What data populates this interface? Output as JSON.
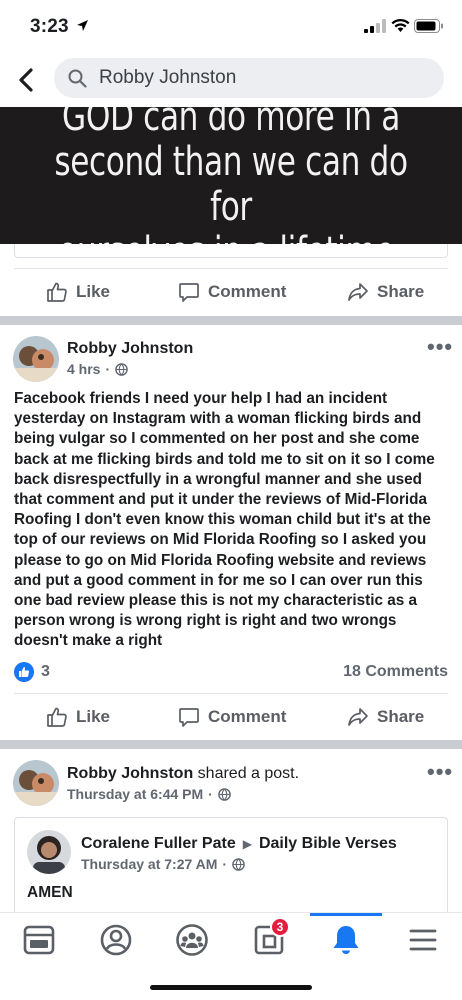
{
  "status_bar": {
    "time": "3:23"
  },
  "header": {
    "search_value": "Robby Johnston"
  },
  "banner": {
    "line1": "GOD can do more in a",
    "line2": "second than we can do for",
    "line3": "ourselves in a lifetime."
  },
  "actions": {
    "like": "Like",
    "comment": "Comment",
    "share": "Share"
  },
  "post1": {
    "author": "Robby Johnston",
    "time": "4 hrs",
    "separator": "·",
    "body": "Facebook friends I need your help I had an incident yesterday on Instagram with a woman flicking birds and being vulgar so I commented on her post and she come back at me flicking birds and told me to sit on it so I come back disrespectfully in a wrongful manner and she used that comment and put it under the reviews of Mid-Florida Roofing I don't even know this woman child but it's at the top of our reviews on Mid Florida Roofing so I asked you please to go on Mid Florida Roofing website and reviews and put a good comment in for me so I can over run this one bad review please this is not my characteristic as a person wrong is wrong right is right and two wrongs doesn't make a right",
    "reaction_count": "3",
    "comments": "18 Comments"
  },
  "post2": {
    "author": "Robby Johnston",
    "action_text": "shared a post.",
    "time": "Thursday at 6:44 PM",
    "separator": "·",
    "shared": {
      "author": "Coralene Fuller Pate",
      "arrow": "▶",
      "page": "Daily Bible Verses",
      "time": "Thursday at 7:27 AM",
      "separator": "·",
      "body": "AMEN"
    }
  },
  "tab_bar": {
    "notification_badge": "3",
    "active_tab": "notifications"
  },
  "colors": {
    "accent": "#1877f2",
    "badge": "#e41e3f",
    "divider": "#c9ccd1"
  }
}
